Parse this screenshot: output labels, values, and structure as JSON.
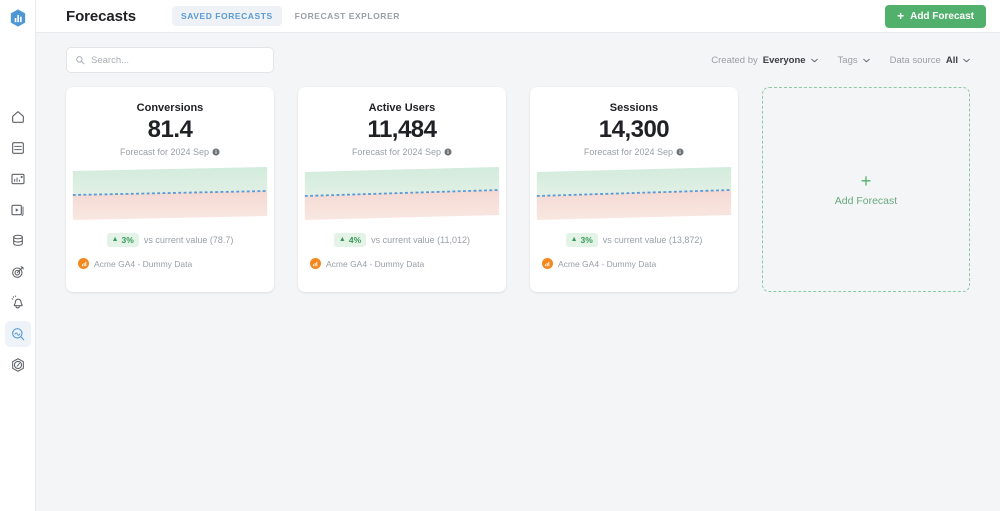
{
  "app": {
    "logo_icon": "bar-chart-hexagon-logo",
    "title": "Forecasts"
  },
  "sidebar": {
    "items": [
      {
        "icon": "home-icon",
        "name": "home",
        "active": false
      },
      {
        "icon": "numbers-report-icon",
        "name": "reports",
        "active": false
      },
      {
        "icon": "dashboard-chart-icon",
        "name": "dashboards",
        "active": false
      },
      {
        "icon": "presentation-icon",
        "name": "presentations",
        "active": false
      },
      {
        "icon": "database-icon",
        "name": "data-sources",
        "active": false
      },
      {
        "icon": "target-goals-icon",
        "name": "goals",
        "active": false
      },
      {
        "icon": "alert-bell-icon",
        "name": "alerts",
        "active": false
      },
      {
        "icon": "forecast-magnifier-icon",
        "name": "forecasts",
        "active": true
      },
      {
        "icon": "speedometer-icon",
        "name": "performance",
        "active": false
      }
    ]
  },
  "tabs": [
    {
      "label": "SAVED FORECASTS",
      "active": true
    },
    {
      "label": "FORECAST EXPLORER",
      "active": false
    }
  ],
  "header": {
    "add_forecast_label": "Add Forecast",
    "add_icon": "plus-icon",
    "accent_green": "#52b06d"
  },
  "search": {
    "placeholder": "Search...",
    "value": "",
    "icon": "search-icon"
  },
  "filters": [
    {
      "label": "Created by",
      "value": "Everyone",
      "name": "created-by"
    },
    {
      "label": "Tags",
      "value": "",
      "name": "tags"
    },
    {
      "label": "Data source",
      "value": "All",
      "name": "data-source"
    }
  ],
  "cards": [
    {
      "title": "Conversions",
      "value": "81.4",
      "subtitle": "Forecast for 2024 Sep",
      "delta": "3%",
      "delta_direction": "up",
      "delta_text": "vs current value (78.7)",
      "source": "Acme GA4 - Dummy Data"
    },
    {
      "title": "Active Users",
      "value": "11,484",
      "subtitle": "Forecast for 2024 Sep",
      "delta": "4%",
      "delta_direction": "up",
      "delta_text": "vs current value (11,012)",
      "source": "Acme GA4 - Dummy Data"
    },
    {
      "title": "Sessions",
      "value": "14,300",
      "subtitle": "Forecast for 2024 Sep",
      "delta": "3%",
      "delta_direction": "up",
      "delta_text": "vs current value (13,872)",
      "source": "Acme GA4 - Dummy Data"
    }
  ],
  "add_card": {
    "label": "Add Forecast",
    "plus": "+"
  },
  "colors": {
    "band_upper": "#d9ece0",
    "band_lower": "#f6dcd7",
    "forecast_line": "#5b9bd5",
    "chip_bg": "#e3f3e7",
    "chip_fg": "#3a9a59",
    "accent_blue": "#5b9bd5"
  }
}
